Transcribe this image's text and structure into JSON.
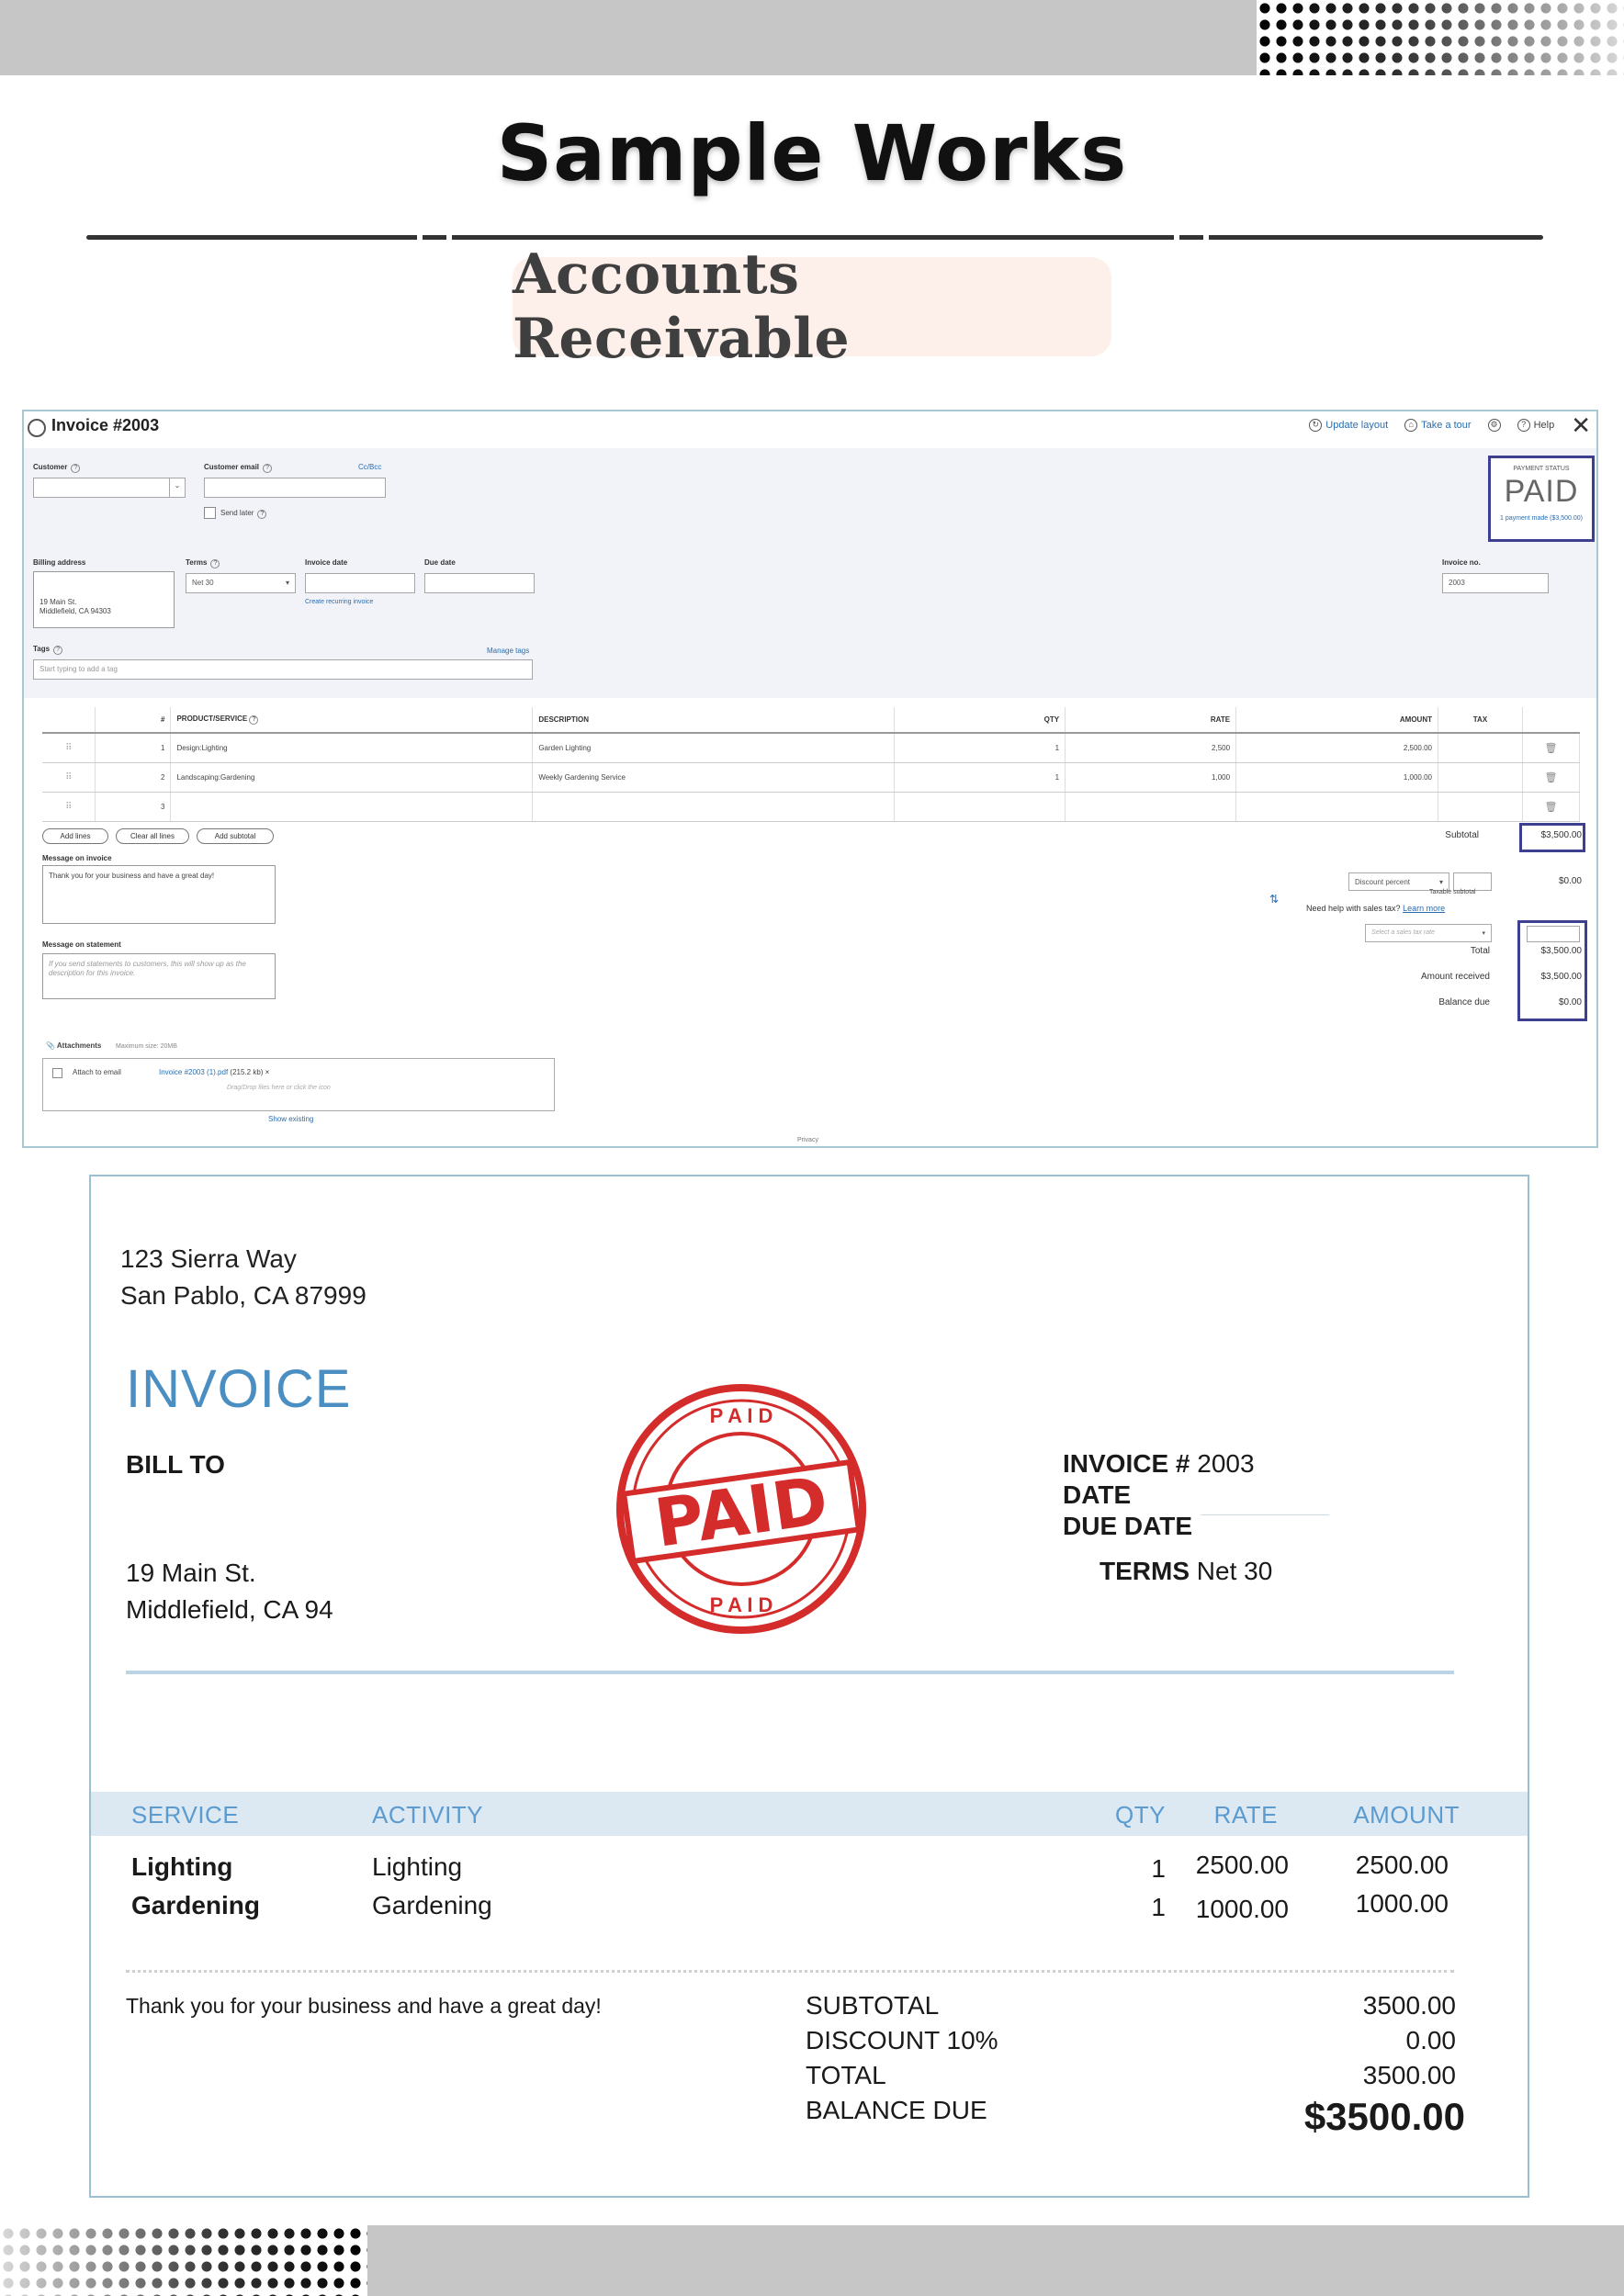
{
  "page": {
    "brand": "Sample Works",
    "section_title": "Accounts Receivable"
  },
  "qb": {
    "title": "Invoice #2003",
    "tools": {
      "update_layout": "Update layout",
      "take_tour": "Take a tour",
      "help": "Help"
    },
    "labels": {
      "customer": "Customer",
      "customer_email": "Customer email",
      "cc_bcc": "Cc/Bcc",
      "send_later": "Send later",
      "billing_address": "Billing address",
      "terms": "Terms",
      "invoice_date": "Invoice date",
      "due_date": "Due date",
      "create_recurring": "Create recurring invoice",
      "invoice_no": "Invoice no.",
      "tags": "Tags",
      "manage_tags": "Manage tags"
    },
    "billing_address": [
      "19 Main St.",
      "Middlefield, CA  94303"
    ],
    "terms_value": "Net 30",
    "invoice_no_value": "2003",
    "tags_placeholder": "Start typing to add a tag",
    "payment_status": {
      "label": "PAYMENT STATUS",
      "value": "PAID",
      "link": "1 payment made ($3,500.00)"
    },
    "table": {
      "headers": {
        "num": "#",
        "product": "PRODUCT/SERVICE",
        "description": "DESCRIPTION",
        "qty": "QTY",
        "rate": "RATE",
        "amount": "AMOUNT",
        "tax": "TAX"
      },
      "rows": [
        {
          "num": "1",
          "product": "Design:Lighting",
          "description": "Garden Lighting",
          "qty": "1",
          "rate": "2,500",
          "amount": "2,500.00"
        },
        {
          "num": "2",
          "product": "Landscaping:Gardening",
          "description": "Weekly Gardening Service",
          "qty": "1",
          "rate": "1,000",
          "amount": "1,000.00"
        },
        {
          "num": "3",
          "product": "",
          "description": "",
          "qty": "",
          "rate": "",
          "amount": ""
        }
      ]
    },
    "buttons": {
      "add_lines": "Add lines",
      "clear_lines": "Clear all lines",
      "add_subtotal": "Add subtotal"
    },
    "message_invoice_label": "Message on invoice",
    "message_invoice": "Thank you for your business and have a great day!",
    "message_statement_label": "Message on statement",
    "message_statement_placeholder": "If you send statements to customers, this will show up as the description for this invoice.",
    "totals": {
      "subtotal_label": "Subtotal",
      "subtotal_value": "$3,500.00",
      "discount_select": "Discount percent",
      "discount_value": "$0.00",
      "taxable_subtotal": "Taxable subtotal",
      "sales_tax_help": "Need help with sales tax?",
      "learn_more": "Learn more",
      "tax_rate_placeholder": "Select a sales tax rate",
      "total_label": "Total",
      "total_value": "$3,500.00",
      "received_label": "Amount received",
      "received_value": "$3,500.00",
      "balance_label": "Balance due",
      "balance_value": "$0.00"
    },
    "attachments": {
      "label": "Attachments",
      "max_size": "Maximum size: 20MB",
      "attach_email": "Attach to email",
      "file": "Invoice #2003 (1).pdf",
      "file_size": "(215.2 kb)",
      "drop_hint": "Drag/Drop files here or click the icon",
      "show_existing": "Show existing"
    },
    "privacy": "Privacy"
  },
  "invoice": {
    "from_address": [
      "123 Sierra Way",
      "San Pablo, CA  87999"
    ],
    "title": "INVOICE",
    "bill_to": "BILL TO",
    "bill_address": [
      "19 Main St.",
      "Middlefield, CA  94"
    ],
    "invoice_no_label": "INVOICE #",
    "invoice_no": "2003",
    "date_label": "DATE",
    "due_date_label": "DUE DATE",
    "terms_label": "TERMS",
    "terms": "Net 30",
    "stamp_text": "PAID",
    "stamp_ring": "P A I D",
    "headers": {
      "service": "SERVICE",
      "activity": "ACTIVITY",
      "qty": "QTY",
      "rate": "RATE",
      "amount": "AMOUNT"
    },
    "lines": [
      {
        "service": "Lighting",
        "activity": "Lighting",
        "qty": "1",
        "rate": "2500.00",
        "amount": "2500.00"
      },
      {
        "service": "Gardening",
        "activity": "Gardening",
        "qty": "1",
        "rate": "1000.00",
        "amount": "1000.00"
      }
    ],
    "message": "Thank you for your business and have a great day!",
    "summary": {
      "subtotal_label": "SUBTOTAL",
      "subtotal": "3500.00",
      "discount_label": "DISCOUNT  10%",
      "discount": "0.00",
      "total_label": "TOTAL",
      "total": "3500.00",
      "balance_label": "BALANCE DUE",
      "balance": "$3500.00"
    }
  },
  "colors": {
    "accent_blue": "#4a8ec2",
    "status_border": "#3e3f8e",
    "stamp_red": "#d42b2b"
  }
}
